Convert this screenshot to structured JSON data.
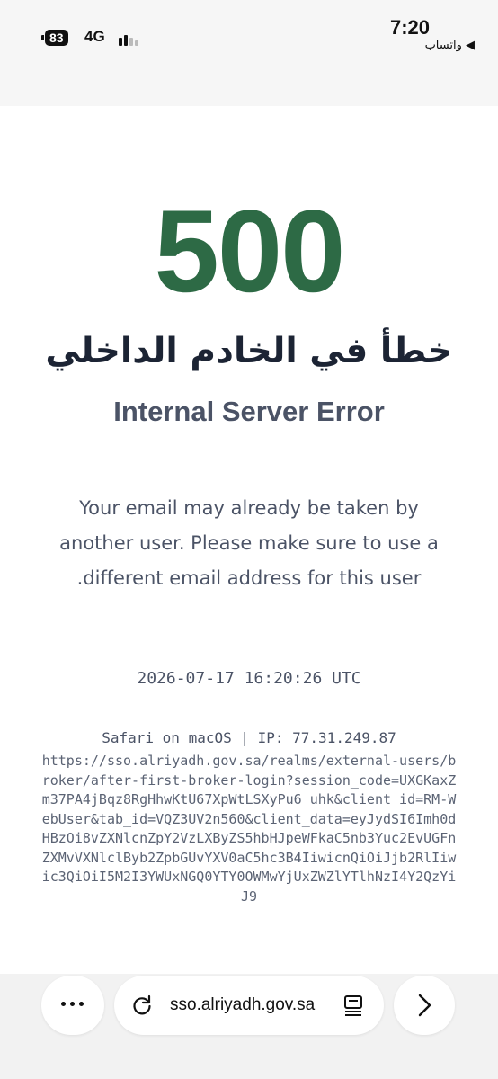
{
  "status_bar": {
    "battery": "83",
    "network": "4G",
    "time": "7:20",
    "back_app": "◀ واتساب"
  },
  "error": {
    "code": "500",
    "title_ar": "خطأ في الخادم الداخلي",
    "title_en": "Internal Server Error",
    "message": "Your email may already be taken by another user. Please make sure to use a different email address for this user.",
    "timestamp": "2026-07-17 16:20:26 UTC",
    "client_info": "Safari on macOS | IP: 77.31.249.87",
    "url": "https://sso.alriyadh.gov.sa/realms/external-users/broker/after-first-broker-login?session_code=UXGKaxZm37PA4jBqz8RgHhwKtU67XpWtLSXyPu6_uhk&client_id=RM-WebUser&tab_id=VQZ3UV2n560&client_data=eyJydSI6Imh0dHBzOi8vZXNlcnZpY2VzLXByZS5hbHJpeWFkaC5nb3Yuc2EvUGFnZXMvVXNlclByb2ZpbGUvYXV0aC5hc3B4IiwicnQiOiJjb2RlIiwic3QiOiI5M2I3YWUxNGQ0YTY0OWMwYjUxZWZlYTlhNzI4Y2QzYiJ9"
  },
  "toolbar": {
    "address": "sso.alriyadh.gov.sa",
    "more_icon": "ellipsis-icon",
    "reload_icon": "reload-icon",
    "reader_icon": "reader-mode-icon",
    "forward_icon": "chevron-right-icon"
  },
  "colors": {
    "accent": "#2d6a45",
    "heading": "#1c2434",
    "text": "#4b5366"
  }
}
